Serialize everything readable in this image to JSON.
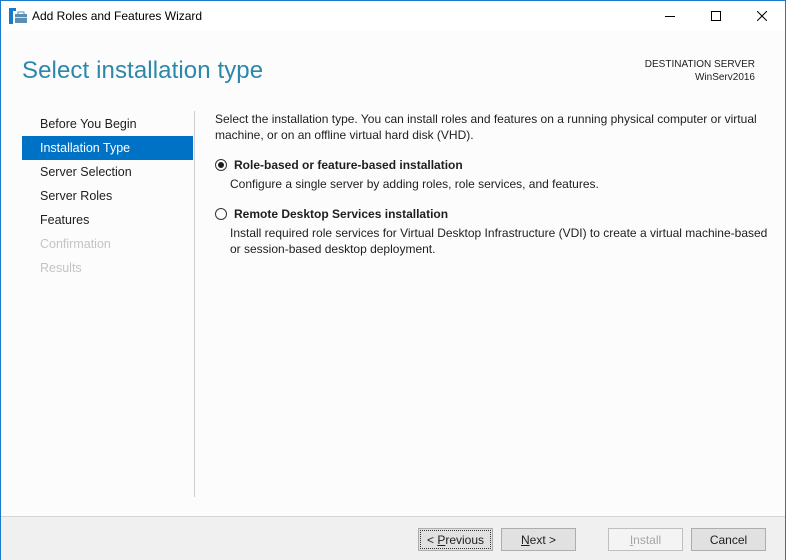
{
  "window": {
    "title": "Add Roles and Features Wizard",
    "icon": "server-manager-icon",
    "controls": [
      "minimize-icon",
      "maximize-icon",
      "close-icon"
    ]
  },
  "header": {
    "title": "Select installation type",
    "destination_label": "DESTINATION SERVER",
    "destination_value": "WinServ2016"
  },
  "nav": {
    "items": [
      {
        "label": "Before You Begin",
        "state": "normal"
      },
      {
        "label": "Installation Type",
        "state": "active"
      },
      {
        "label": "Server Selection",
        "state": "normal"
      },
      {
        "label": "Server Roles",
        "state": "normal"
      },
      {
        "label": "Features",
        "state": "normal"
      },
      {
        "label": "Confirmation",
        "state": "disabled"
      },
      {
        "label": "Results",
        "state": "disabled"
      }
    ]
  },
  "content": {
    "intro": "Select the installation type. You can install roles and features on a running physical computer or virtual machine, or on an offline virtual hard disk (VHD).",
    "options": [
      {
        "label": "Role-based or feature-based installation",
        "description": "Configure a single server by adding roles, role services, and features.",
        "selected": true
      },
      {
        "label": "Remote Desktop Services installation",
        "description": "Install required role services for Virtual Desktop Infrastructure (VDI) to create a virtual machine-based or session-based desktop deployment.",
        "selected": false
      }
    ]
  },
  "footer": {
    "previous": {
      "prefix": "< ",
      "mnemonic": "P",
      "rest": "revious"
    },
    "next": {
      "mnemonic": "N",
      "rest": "ext >"
    },
    "install": {
      "mnemonic": "I",
      "rest": "nstall",
      "disabled": true
    },
    "cancel": "Cancel"
  },
  "colors": {
    "accent": "#0072c6",
    "title": "#2b88ab",
    "window_border": "#1979ca"
  }
}
